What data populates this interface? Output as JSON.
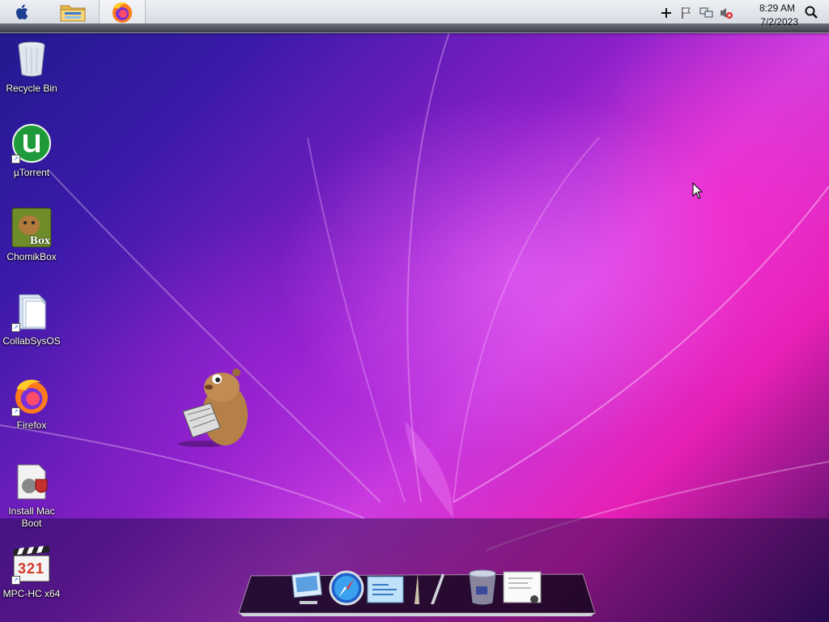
{
  "menubar": {
    "apple_icon": "apple-icon",
    "pinned": [
      {
        "name": "file-explorer",
        "icon": "folder-icon"
      },
      {
        "name": "firefox",
        "icon": "firefox-icon",
        "active": true
      }
    ],
    "tray": [
      "add-icon",
      "flag-icon",
      "network-icon",
      "volume-muted-icon"
    ],
    "clock": {
      "time": "8:29 AM",
      "date": "7/2/2023"
    },
    "search_icon": "search-icon"
  },
  "desktop": {
    "icons": [
      {
        "label": "Recycle Bin",
        "icon": "recycle-bin-icon"
      },
      {
        "label": "µTorrent",
        "icon": "utorrent-icon"
      },
      {
        "label": "ChomikBox",
        "icon": "chomikbox-icon",
        "badge": "Box"
      },
      {
        "label": "CollabSysOS",
        "icon": "folder-icon"
      },
      {
        "label": "Firefox",
        "icon": "firefox-icon"
      },
      {
        "label": "Install Mac Boot",
        "icon": "installer-icon"
      },
      {
        "label": "MPC-HC x64",
        "icon": "mpc-hc-icon",
        "badge": "321"
      }
    ]
  },
  "dock": {
    "items": [
      "finder-icon",
      "safari-icon",
      "mail-icon",
      "launchpad-icon",
      "trash-icon",
      "preview-icon"
    ]
  },
  "colors": {
    "accent": "#c23be0",
    "wallpaper_pink": "#e51fb4",
    "wallpaper_blue": "#1f1a8c"
  }
}
